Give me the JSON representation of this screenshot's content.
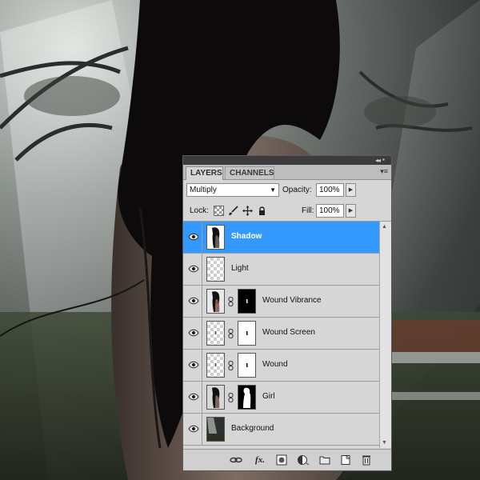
{
  "panel": {
    "tabs": [
      {
        "label": "LAYERS",
        "active": true
      },
      {
        "label": "CHANNELS",
        "active": false
      }
    ],
    "collapse_icon": "double-chevron-right-icon",
    "close_icon": "close-icon",
    "menu_icon": "panel-menu-icon",
    "blend_mode": "Multiply",
    "opacity_label": "Opacity:",
    "opacity_value": "100%",
    "lock_label": "Lock:",
    "fill_label": "Fill:",
    "fill_value": "100%",
    "selection_color": "#3399ff"
  },
  "layers": [
    {
      "name": "Shadow",
      "selected": true,
      "visible": true,
      "has_mask": false
    },
    {
      "name": "Light",
      "selected": false,
      "visible": true,
      "has_mask": false
    },
    {
      "name": "Wound Vibrance",
      "selected": false,
      "visible": true,
      "has_mask": true
    },
    {
      "name": "Wound Screen",
      "selected": false,
      "visible": true,
      "has_mask": true
    },
    {
      "name": "Wound",
      "selected": false,
      "visible": true,
      "has_mask": true
    },
    {
      "name": "Girl",
      "selected": false,
      "visible": true,
      "has_mask": true
    },
    {
      "name": "Background",
      "selected": false,
      "visible": true,
      "has_mask": false
    }
  ],
  "bottom_icons": [
    "link-layers-icon",
    "fx-icon",
    "add-mask-icon",
    "adjustment-layer-icon",
    "new-group-icon",
    "new-layer-icon",
    "trash-icon"
  ]
}
